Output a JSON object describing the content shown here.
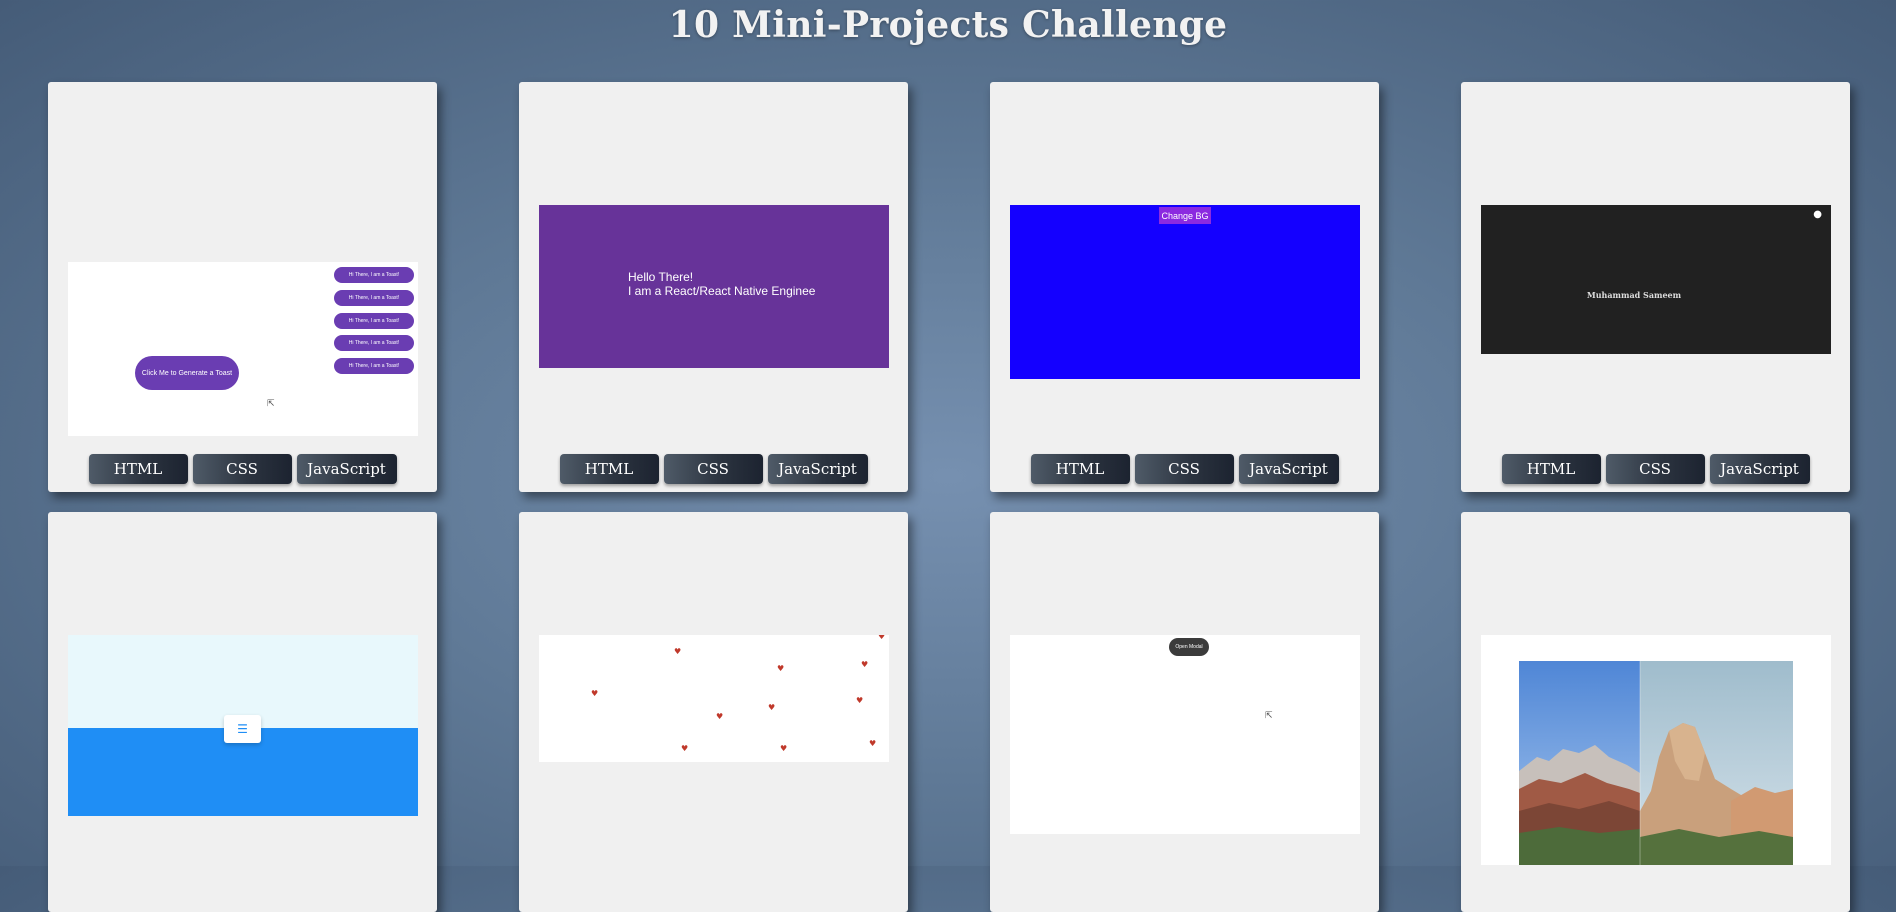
{
  "page": {
    "title": "10 Mini-Projects Challenge"
  },
  "cards": [
    {
      "buttons": [
        "HTML",
        "CSS",
        "JavaScript"
      ]
    },
    {
      "buttons": [
        "HTML",
        "CSS",
        "JavaScript"
      ]
    },
    {
      "buttons": [
        "HTML",
        "CSS",
        "JavaScript"
      ]
    },
    {
      "buttons": [
        "HTML",
        "CSS",
        "JavaScript"
      ]
    }
  ],
  "previews": {
    "toast": {
      "toasts": [
        "Hi There, I am a Toast!",
        "Hi There, I am a Toast!",
        "Hi There, I am a Toast!",
        "Hi There, I am a Toast!",
        "Hi There, I am a Toast!"
      ],
      "generate_label": "Click Me to Generate a Toast"
    },
    "typing": {
      "line1": "Hello There!",
      "line2": "I am a React/React Native Enginee"
    },
    "bg_changer": {
      "button_label": "Change BG"
    },
    "theme": {
      "name": "Muhammad Sameem"
    },
    "modal": {
      "button_label": "Open Modal"
    }
  },
  "colors": {
    "purple": "#6a3db2",
    "typing_bg": "#673399",
    "blue": "#1400ff",
    "dark": "#212121",
    "sky": "#1f8ef5"
  }
}
